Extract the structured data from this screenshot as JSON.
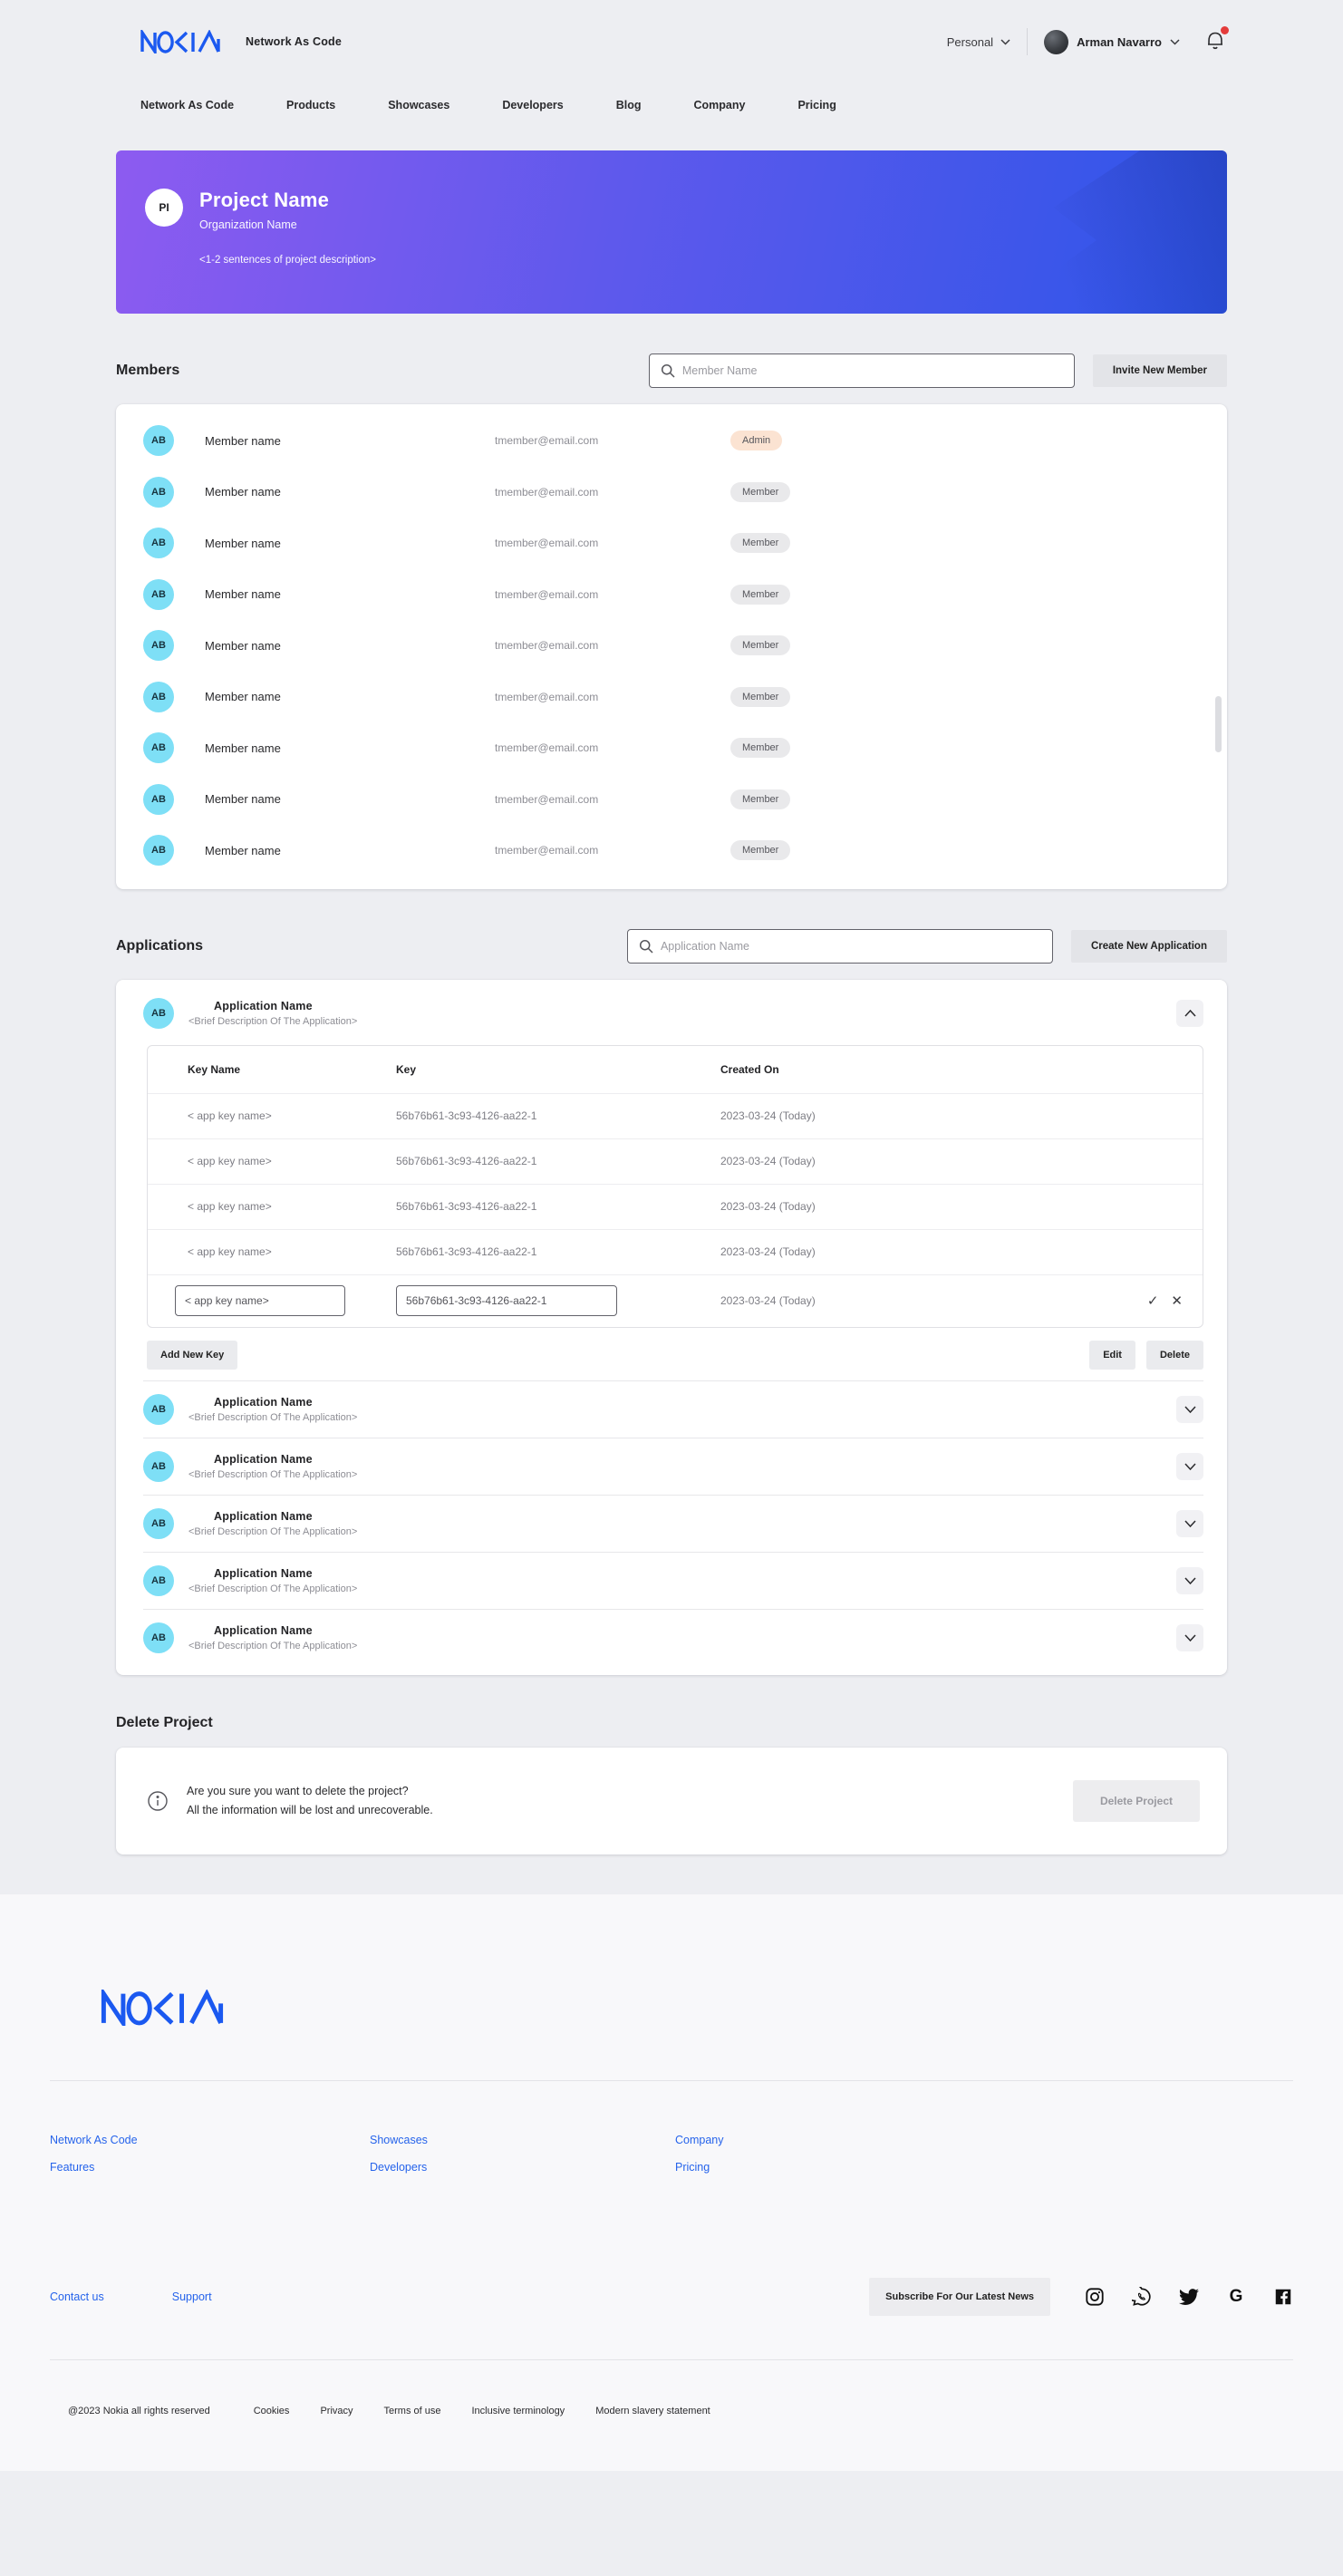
{
  "header": {
    "logo": "NOKIA",
    "app_name": "Network As Code",
    "workspace_selector": "Personal",
    "user_name": "Arman Navarro"
  },
  "nav": {
    "items": [
      "Network As Code",
      "Products",
      "Showcases",
      "Developers",
      "Blog",
      "Company",
      "Pricing"
    ]
  },
  "banner": {
    "avatar_initials": "PI",
    "title": "Project Name",
    "organization": "Organization Name",
    "description": "<1-2 sentences of project description>"
  },
  "members": {
    "heading": "Members",
    "search_placeholder": "Member Name",
    "invite_button": "Invite New Member",
    "rows": [
      {
        "initials": "AB",
        "name": "Member name",
        "email": "tmember@email.com",
        "role": "Admin"
      },
      {
        "initials": "AB",
        "name": "Member name",
        "email": "tmember@email.com",
        "role": "Member"
      },
      {
        "initials": "AB",
        "name": "Member name",
        "email": "tmember@email.com",
        "role": "Member"
      },
      {
        "initials": "AB",
        "name": "Member name",
        "email": "tmember@email.com",
        "role": "Member"
      },
      {
        "initials": "AB",
        "name": "Member name",
        "email": "tmember@email.com",
        "role": "Member"
      },
      {
        "initials": "AB",
        "name": "Member name",
        "email": "tmember@email.com",
        "role": "Member"
      },
      {
        "initials": "AB",
        "name": "Member name",
        "email": "tmember@email.com",
        "role": "Member"
      },
      {
        "initials": "AB",
        "name": "Member name",
        "email": "tmember@email.com",
        "role": "Member"
      },
      {
        "initials": "AB",
        "name": "Member name",
        "email": "tmember@email.com",
        "role": "Member"
      }
    ]
  },
  "applications": {
    "heading": "Applications",
    "search_placeholder": "Application Name",
    "create_button": "Create New Application",
    "expanded": {
      "initials": "AB",
      "name": "Application Name",
      "description": "<Brief Description Of The Application>",
      "table": {
        "headers": [
          "Key Name",
          "Key",
          "Created On"
        ],
        "rows": [
          {
            "key_name": "< app key name>",
            "key": "56b76b61-3c93-4126-aa22-1",
            "created": "2023-03-24 (Today)"
          },
          {
            "key_name": "< app key name>",
            "key": "56b76b61-3c93-4126-aa22-1",
            "created": "2023-03-24 (Today)"
          },
          {
            "key_name": "< app key name>",
            "key": "56b76b61-3c93-4126-aa22-1",
            "created": "2023-03-24 (Today)"
          },
          {
            "key_name": "< app key name>",
            "key": "56b76b61-3c93-4126-aa22-1",
            "created": "2023-03-24 (Today)"
          }
        ],
        "edit_row": {
          "key_name_value": "< app key name>",
          "key_value": "56b76b61-3c93-4126-aa22-1",
          "created": "2023-03-24 (Today)",
          "confirm_icon": "check",
          "cancel_icon": "x"
        }
      },
      "add_key_button": "Add New Key",
      "edit_button": "Edit",
      "delete_button": "Delete"
    },
    "collapsed": [
      {
        "initials": "AB",
        "name": "Application Name",
        "description": "<Brief Description Of The Application>"
      },
      {
        "initials": "AB",
        "name": "Application Name",
        "description": "<Brief Description Of The Application>"
      },
      {
        "initials": "AB",
        "name": "Application Name",
        "description": "<Brief Description Of The Application>"
      },
      {
        "initials": "AB",
        "name": "Application Name",
        "description": "<Brief Description Of The Application>"
      },
      {
        "initials": "AB",
        "name": "Application Name",
        "description": "<Brief Description Of The Application>"
      }
    ]
  },
  "delete_project": {
    "heading": "Delete Project",
    "warning_line1": "Are you sure you want to delete the project?",
    "warning_line2": "All the information will be lost and unrecoverable.",
    "button": "Delete Project"
  },
  "footer": {
    "logo": "NOKIA",
    "link_columns": [
      [
        "Network As Code",
        "Features"
      ],
      [
        "Showcases",
        "Developers"
      ],
      [
        "Company",
        "Pricing"
      ]
    ],
    "contact_links": [
      "Contact us",
      "Support"
    ],
    "subscribe_button": "Subscribe For Our Latest News",
    "social_icons": [
      "instagram",
      "whatsapp",
      "twitter",
      "google",
      "facebook"
    ],
    "copyright": "@2023 Nokia all rights reserved",
    "legal_links": [
      "Cookies",
      "Privacy",
      "Terms of use",
      "Inclusive terminology",
      "Modern slavery statement"
    ]
  },
  "colors": {
    "brand_blue": "#1B59F0",
    "accent_cyan": "#7EDFF6",
    "admin_badge": "#FBE3D2",
    "member_badge": "#E9E9EB",
    "banner_gradient_from": "#8D5BF0",
    "banner_gradient_to": "#2D55E9",
    "notification_red": "#E43B3B"
  }
}
